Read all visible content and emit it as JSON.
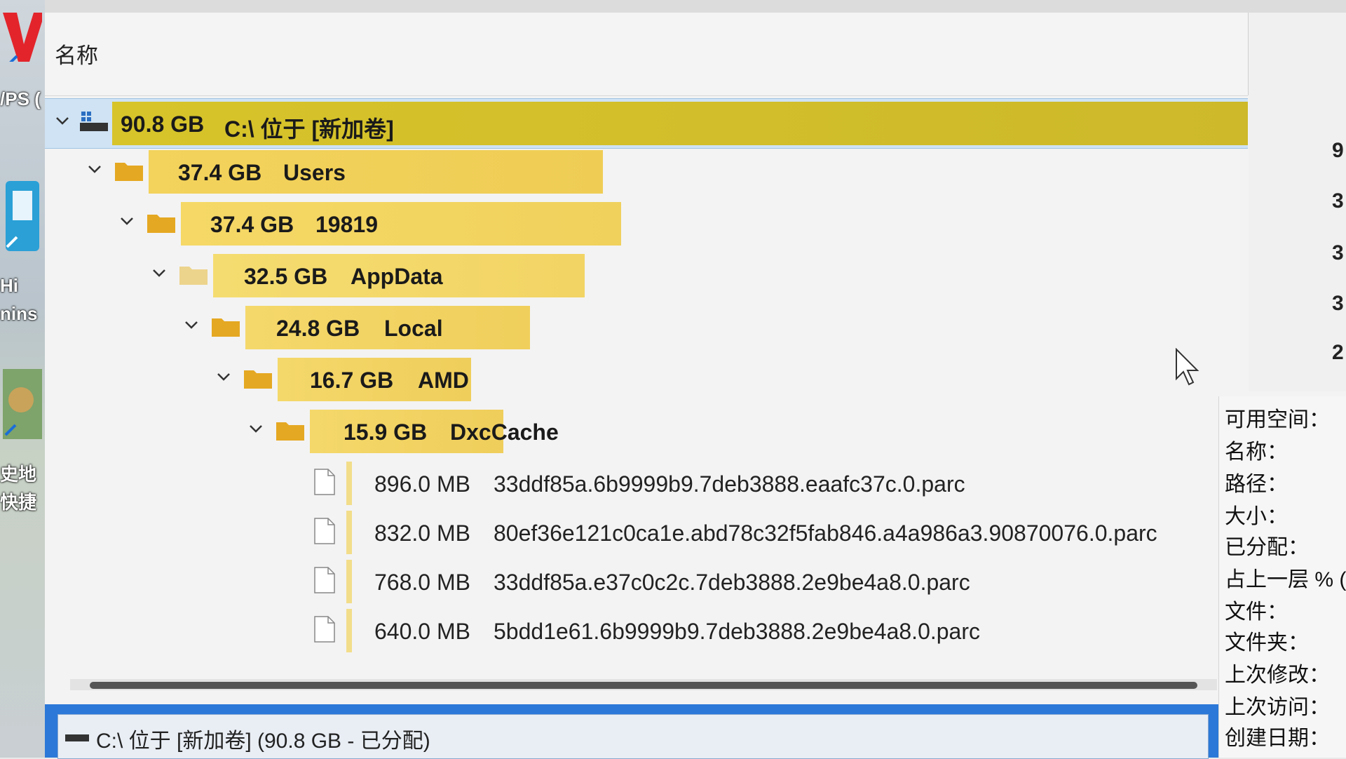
{
  "header": {
    "name_column": "名称"
  },
  "tree": [
    {
      "size": "90.8 GB",
      "label": "C:\\  位于  [新加卷]",
      "kind": "drive"
    },
    {
      "size": "37.4 GB",
      "label": "Users",
      "kind": "folder"
    },
    {
      "size": "37.4 GB",
      "label": "19819",
      "kind": "folder"
    },
    {
      "size": "32.5 GB",
      "label": "AppData",
      "kind": "folder-light"
    },
    {
      "size": "24.8 GB",
      "label": "Local",
      "kind": "folder"
    },
    {
      "size": "16.7 GB",
      "label": "AMD",
      "kind": "folder"
    },
    {
      "size": "15.9 GB",
      "label": "DxcCache",
      "kind": "folder"
    }
  ],
  "files": [
    {
      "size": "896.0 MB",
      "label": "33ddf85a.6b9999b9.7deb3888.eaafc37c.0.parc"
    },
    {
      "size": "832.0 MB",
      "label": "80ef36e121c0ca1e.abd78c32f5fab846.a4a986a3.90870076.0.parc"
    },
    {
      "size": "768.0 MB",
      "label": "33ddf85a.e37c0c2c.7deb3888.2e9be4a8.0.parc"
    },
    {
      "size": "640.0 MB",
      "label": "5bdd1e61.6b9999b9.7deb3888.2e9be4a8.0.parc"
    }
  ],
  "properties": [
    "可用空间：",
    "名称：",
    "路径：",
    "大小：",
    "已分配：",
    "占上一层 % (已分",
    "文件：",
    "文件夹：",
    "上次修改：",
    "上次访问：",
    "创建日期："
  ],
  "status_bar": {
    "text": "C:\\  位于  [新加卷] (90.8 GB - 已分配)"
  },
  "desktop": {
    "label_1": "/PS (",
    "label_2": "Hi",
    "label_3": "nins",
    "label_4": "史地",
    "label_5": "快捷"
  },
  "right_digits": [
    "9",
    "3",
    "3",
    "3",
    "2"
  ],
  "colors": {
    "accent": "#2b78d8",
    "root_bar": "#d7c42a",
    "folder_bar": "#f3d35c",
    "selection": "#cfe3f4"
  }
}
